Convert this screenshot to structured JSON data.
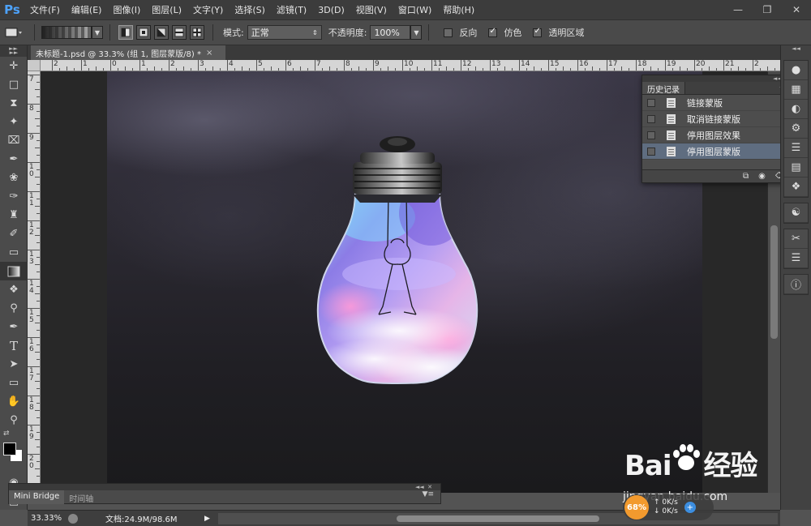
{
  "app": {
    "logo": "Ps"
  },
  "menu": [
    "文件(F)",
    "编辑(E)",
    "图像(I)",
    "图层(L)",
    "文字(Y)",
    "选择(S)",
    "滤镜(T)",
    "3D(D)",
    "视图(V)",
    "窗口(W)",
    "帮助(H)"
  ],
  "options": {
    "mode_label": "模式:",
    "mode_value": "正常",
    "opacity_label": "不透明度:",
    "opacity_value": "100%",
    "reverse_label": "反向",
    "dither_label": "仿色",
    "transparency_label": "透明区域",
    "reverse_checked": false,
    "dither_checked": true,
    "transparency_checked": true
  },
  "document": {
    "tab_title": "未标题-1.psd @ 33.3% (组 1, 图层蒙版/8) *"
  },
  "ruler": {
    "h_labels": [
      "2",
      "1",
      "0",
      "1",
      "2",
      "3",
      "4",
      "5",
      "6",
      "7",
      "8",
      "9",
      "10",
      "11",
      "12",
      "13",
      "14",
      "15",
      "16",
      "17",
      "18",
      "19",
      "20",
      "21",
      "2"
    ],
    "v_labels": [
      "7",
      "8",
      "9",
      "1 0",
      "1 1",
      "1 2",
      "1 3",
      "1 4",
      "1 5",
      "1 6",
      "1 7",
      "1 8",
      "1 9",
      "2 0",
      "2 1"
    ]
  },
  "history": {
    "title": "历史记录",
    "items": [
      {
        "label": "链接蒙版",
        "selected": false
      },
      {
        "label": "取消链接蒙版",
        "selected": false
      },
      {
        "label": "停用图层效果",
        "selected": false
      },
      {
        "label": "停用图层蒙版",
        "selected": true
      }
    ]
  },
  "bottom_panel": {
    "tabs": [
      "Mini Bridge",
      "时间轴"
    ]
  },
  "status": {
    "zoom": "33.33%",
    "doc_size": "文档:24.9M/98.6M"
  },
  "watermark": {
    "logo_text_left": "Bai",
    "logo_text_right": "经验",
    "url": "jingyan.baidu.com"
  },
  "speed_badge": {
    "percent": "68%",
    "up": "0K/s",
    "down": "0K/s"
  },
  "colors": {
    "menubar": "#3c3c3c",
    "panel": "#4d4d4d",
    "selection": "#5f6d80",
    "ps_blue": "#4da3ff",
    "badge_orange": "#f29a2e"
  }
}
